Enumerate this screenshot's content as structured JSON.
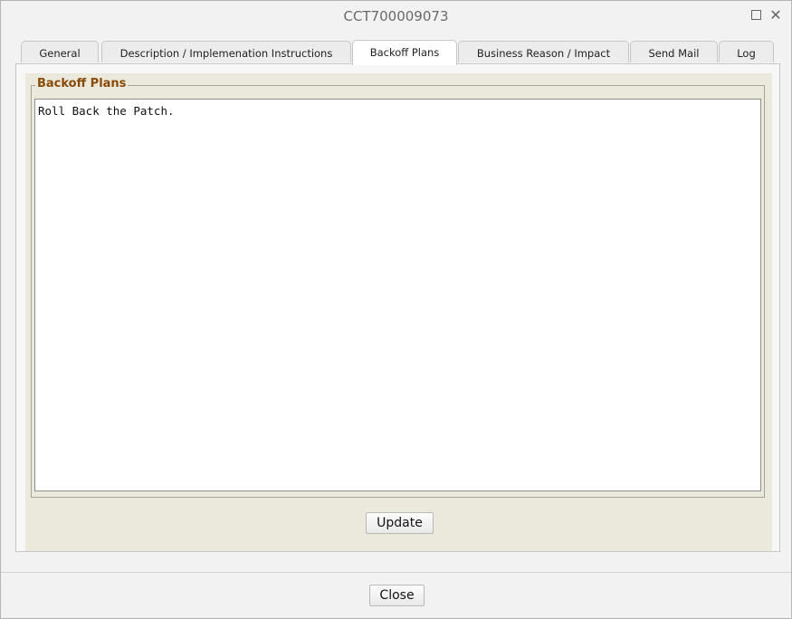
{
  "window": {
    "title": "CCT700009073",
    "maximize_icon": "maximize-icon",
    "close_icon": "close-icon",
    "close_glyph": "✕"
  },
  "tabs": [
    {
      "label": "General",
      "active": false
    },
    {
      "label": "Description / Implemenation Instructions",
      "active": false
    },
    {
      "label": "Backoff Plans",
      "active": true
    },
    {
      "label": "Business Reason / Impact",
      "active": false
    },
    {
      "label": "Send Mail",
      "active": false
    },
    {
      "label": "Log",
      "active": false
    }
  ],
  "backoff_panel": {
    "legend": "Backoff Plans",
    "text_value": "Roll Back the Patch.",
    "update_label": "Update"
  },
  "footer": {
    "close_label": "Close"
  },
  "colors": {
    "legend": "#8a4b0a",
    "panel_background": "#ebe9dc"
  }
}
